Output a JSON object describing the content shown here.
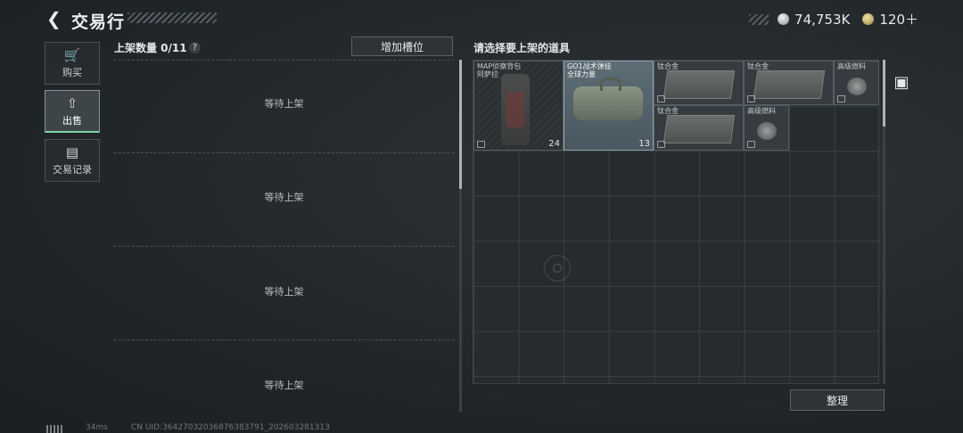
{
  "header": {
    "back_icon": "chevron-left-icon",
    "title": "交易行",
    "currencies": [
      {
        "icon": "silver-coin-icon",
        "value": "74,753K"
      },
      {
        "icon": "gold-coin-icon",
        "value": "120＋"
      }
    ]
  },
  "sidebar": {
    "items": [
      {
        "label": "购买",
        "icon": "cart-icon",
        "active": false
      },
      {
        "label": "出售",
        "icon": "cart-upload-icon",
        "active": true
      },
      {
        "label": "交易记录",
        "icon": "record-icon",
        "active": false
      }
    ]
  },
  "listing": {
    "count_label": "上架数量 0/11",
    "help": "?",
    "add_slot_button": "增加槽位",
    "slots": [
      "等待上架",
      "等待上架",
      "等待上架",
      "等待上架"
    ]
  },
  "inventory": {
    "title": "请选择要上架的道具",
    "items": [
      {
        "name": "MAP侦察背包\n阿萨拉",
        "count": "24",
        "style": "dark"
      },
      {
        "name": "GO1战术弹挂\n全球力量",
        "count": "13",
        "style": "sel"
      },
      {
        "name": "钛合金",
        "count": "",
        "style": "plain"
      },
      {
        "name": "钛合金",
        "count": "",
        "style": "plain"
      },
      {
        "name": "高级燃料",
        "count": "",
        "style": "plain"
      },
      {
        "name": "钛合金",
        "count": "",
        "style": "plain"
      },
      {
        "name": "高级燃料",
        "count": "",
        "style": "plain"
      }
    ],
    "sort_button": "整理",
    "side_tab_icon": "backpack-icon"
  },
  "footer": {
    "ping": "34ms",
    "uid": "CN UID:364270320368763837​91_202603281313"
  }
}
